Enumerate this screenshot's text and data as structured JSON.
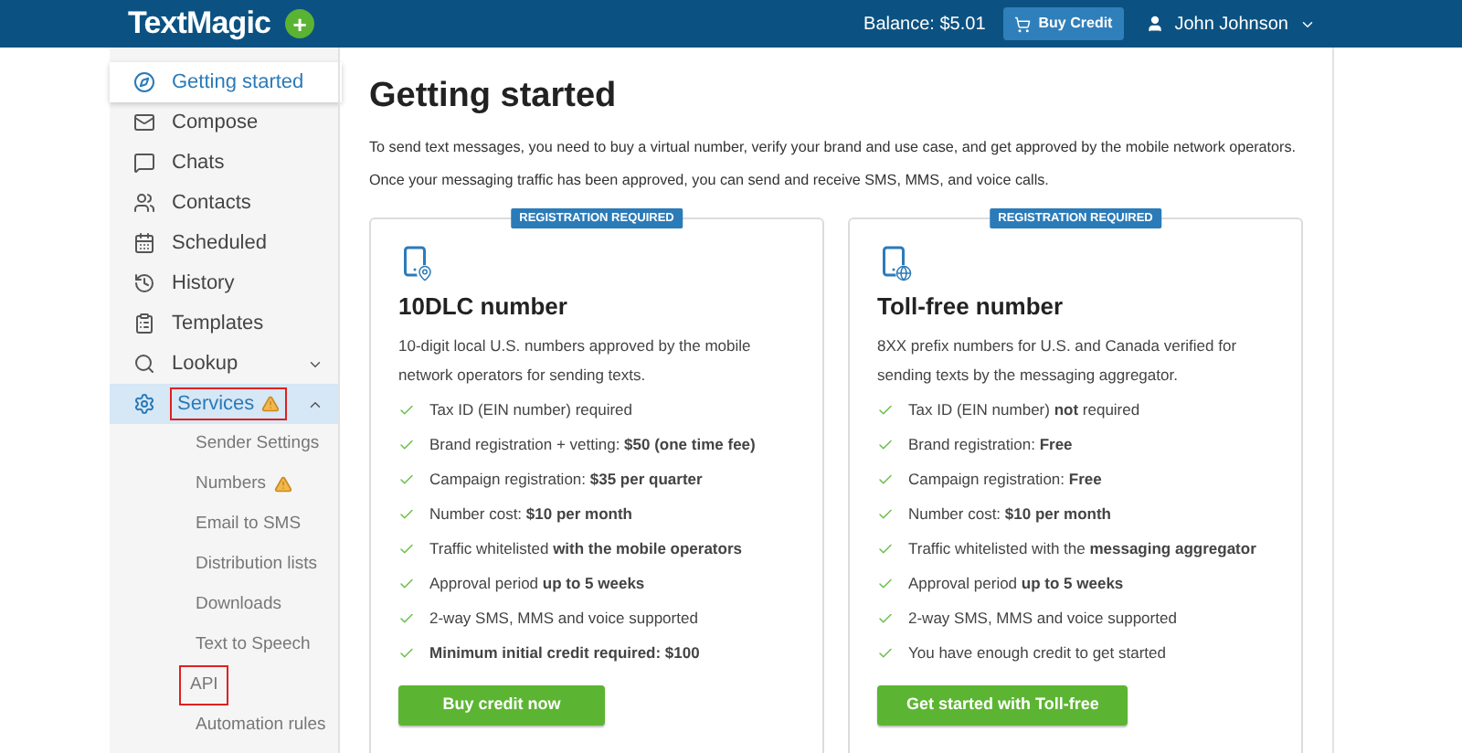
{
  "header": {
    "logo": "TextMagic",
    "add_button": "+",
    "balance": "Balance: $5.01",
    "buy_credit": "Buy Credit",
    "user": "John Johnson"
  },
  "sidebar": {
    "items": [
      {
        "label": "Getting started",
        "selected": true,
        "outlined": false,
        "warning": false
      },
      {
        "label": "Compose",
        "selected": false,
        "outlined": false,
        "warning": false
      },
      {
        "label": "Chats",
        "selected": false,
        "outlined": false,
        "warning": false
      },
      {
        "label": "Contacts",
        "selected": false,
        "outlined": false,
        "warning": false
      },
      {
        "label": "Scheduled",
        "selected": false,
        "outlined": false,
        "warning": false
      },
      {
        "label": "History",
        "selected": false,
        "outlined": false,
        "warning": false
      },
      {
        "label": "Templates",
        "selected": false,
        "outlined": false,
        "warning": false
      },
      {
        "label": "Lookup",
        "selected": false,
        "outlined": false,
        "warning": false,
        "expanded": false
      },
      {
        "label": "Services",
        "selected": true,
        "outlined": true,
        "warning": true,
        "expanded": true,
        "children": [
          {
            "label": "Sender Settings",
            "outlined": false,
            "warning": false
          },
          {
            "label": "Numbers",
            "outlined": false,
            "warning": true
          },
          {
            "label": "Email to SMS",
            "outlined": false,
            "warning": false
          },
          {
            "label": "Distribution lists",
            "outlined": false,
            "warning": false
          },
          {
            "label": "Downloads",
            "outlined": false,
            "warning": false
          },
          {
            "label": "Text to Speech",
            "outlined": false,
            "warning": false
          },
          {
            "label": "API",
            "outlined": true,
            "warning": false
          },
          {
            "label": "Automation rules",
            "outlined": false,
            "warning": false
          }
        ]
      }
    ]
  },
  "main": {
    "title": "Getting started",
    "intro": [
      "To send text messages, you need to buy a virtual number, verify your brand and use case, and get approved by the mobile network operators.",
      "Once your messaging traffic has been approved, you can send and receive SMS, MMS, and voice calls."
    ],
    "cards": [
      {
        "badge": "REGISTRATION REQUIRED",
        "title": "10DLC number",
        "description": "10-digit local U.S. numbers approved by the mobile network operators for sending texts.",
        "features": [
          "Tax ID (EIN number) required",
          "Brand registration + vetting: **$50 (one time fee)**",
          "Campaign registration: **$35 per quarter**",
          "Number cost: **$10 per month**",
          "Traffic whitelisted **with the mobile operators**",
          "Approval period **up to 5 weeks**",
          "2-way SMS, MMS and voice supported",
          "**Minimum initial credit required: $100**"
        ],
        "button": "Buy credit now"
      },
      {
        "badge": "REGISTRATION REQUIRED",
        "title": "Toll-free number",
        "description": "8XX prefix numbers for U.S. and Canada verified for sending texts by the messaging aggregator.",
        "features": [
          "Tax ID (EIN number) **not** required",
          "Brand registration: **Free**",
          "Campaign registration: **Free**",
          "Number cost: **$10 per month**",
          "Traffic whitelisted with the **messaging aggregator**",
          "Approval period **up to 5 weeks**",
          "2-way SMS, MMS and voice supported",
          "You have enough credit to get started"
        ],
        "button": "Get started with Toll-free"
      }
    ]
  }
}
